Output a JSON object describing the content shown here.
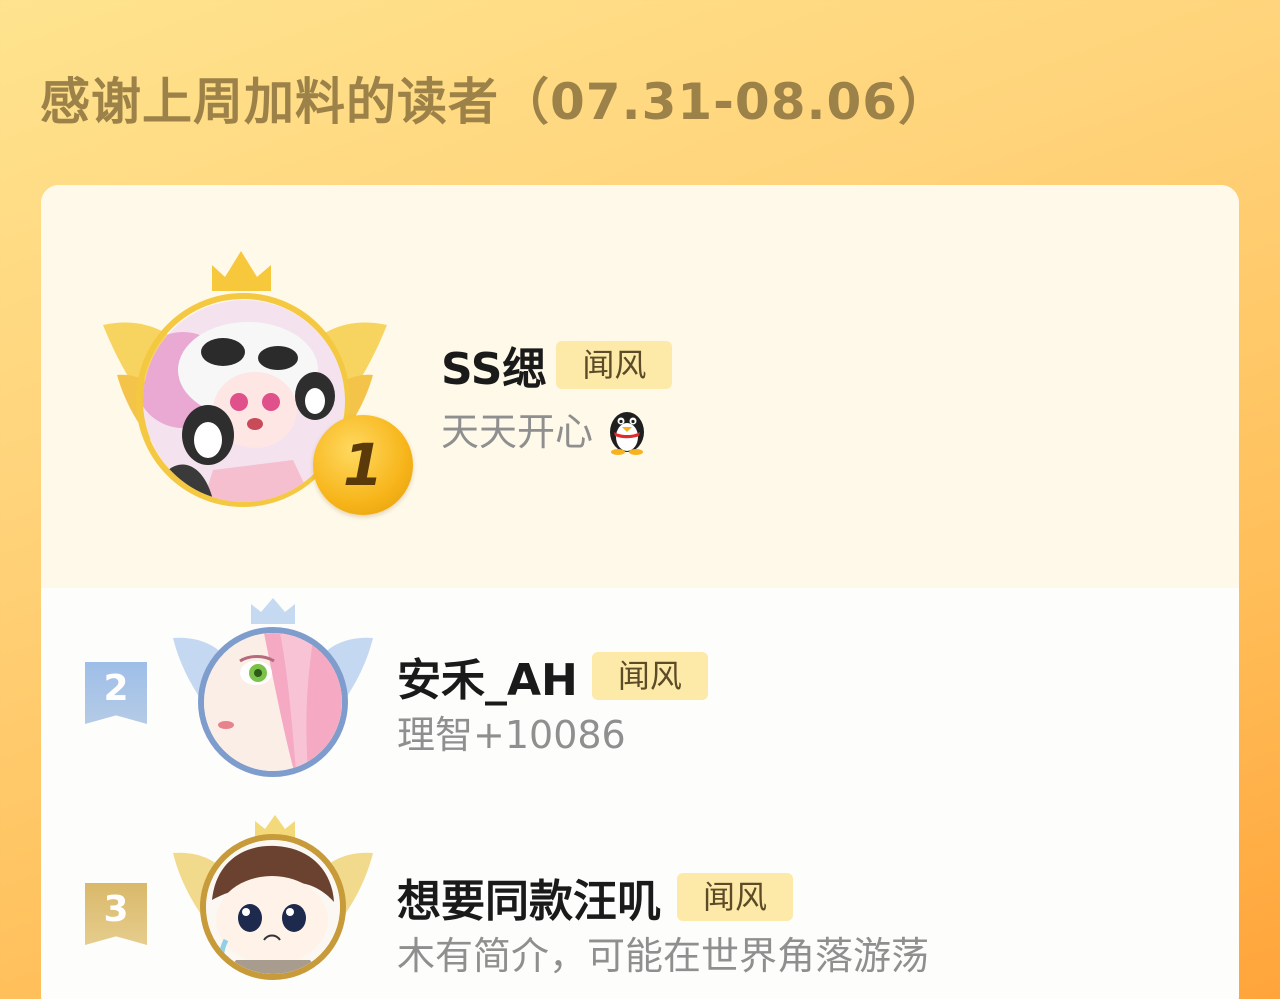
{
  "header": {
    "title": "感谢上周加料的读者（07.31-08.06）"
  },
  "ranking": [
    {
      "rank": "1",
      "name": "SS缌",
      "badge": "闻风",
      "bio": "天天开心",
      "bio_icon": "penguin-icon",
      "frame_color": "#f5c842"
    },
    {
      "rank": "2",
      "name": "安禾_AH",
      "badge": "闻风",
      "bio": "理智+10086",
      "frame_color": "#8aaee0"
    },
    {
      "rank": "3",
      "name": "想要同款汪叽",
      "badge": "闻风",
      "bio": "木有简介，可能在世界角落游荡",
      "frame_color": "#d9b05a"
    }
  ],
  "colors": {
    "title_color": "#9c8248",
    "badge_bg": "#fdeaa8",
    "card_bg": "#fdfdfb",
    "first_section_bg": "#fef9e9"
  }
}
